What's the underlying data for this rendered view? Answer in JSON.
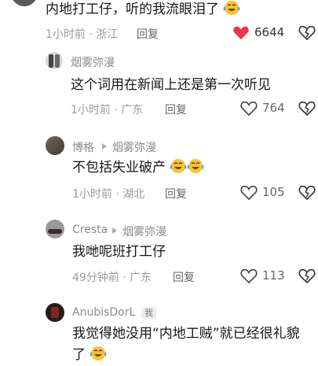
{
  "comments": [
    {
      "text": "内地打工仔，听的我流眼泪了",
      "meta": "1小时前 · 浙江",
      "reply": "回复",
      "likes": "6644",
      "liked": true
    },
    {
      "author": "烟雾弥漫",
      "text": "这个词用在新闻上还是第一次听见",
      "meta": "1小时前 · 广东",
      "reply": "回复",
      "likes": "764"
    },
    {
      "author": "博格",
      "reply_to": "烟雾弥漫",
      "text": "不包括失业破产",
      "meta": "1小时前 · 湖北",
      "reply": "回复",
      "likes": "105"
    },
    {
      "author": "Cresta",
      "reply_to": "烟雾弥漫",
      "text": "我哋呢班打工仔",
      "meta": "49分钟前 · 广东",
      "reply": "回复",
      "likes": "113"
    },
    {
      "author": "AnubisDorL",
      "badge": "我",
      "text_line1": "我觉得她没用“内地工贼”就已经很礼貌",
      "text_line2": "了"
    }
  ],
  "colors": {
    "like_red": "#f0334a",
    "meta_gray": "#9a9a9a",
    "name_gray": "#8c8c8c"
  },
  "icons": [
    "heart-icon",
    "dislike-icon",
    "emoji-laugh-cry-icon",
    "reply-arrow-icon"
  ]
}
